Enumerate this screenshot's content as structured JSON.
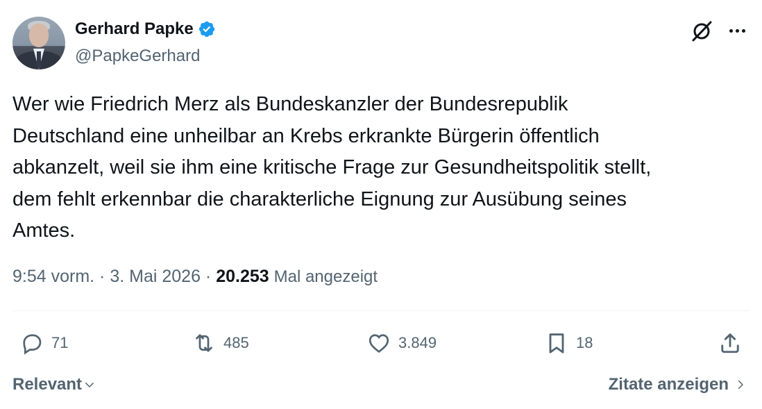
{
  "author": {
    "name": "Gerhard Papke",
    "handle": "@PapkeGerhard",
    "verified": true
  },
  "tweet": {
    "text": "Wer wie Friedrich Merz als Bundeskanzler der Bundesrepublik\nDeutschland eine unheilbar an Krebs erkrankte Bürgerin öffentlich\nabkanzelt, weil sie ihm eine kritische Frage zur Gesundheitspolitik stellt,\ndem fehlt erkennbar die charakterliche Eignung zur Ausübung seines\nAmtes."
  },
  "meta": {
    "time": "9:54 vorm.",
    "separator1": " · ",
    "date": "3. Mai 2026",
    "separator2": " · ",
    "views": "20.253",
    "views_label": "Mal angezeigt"
  },
  "actions": {
    "replies": "71",
    "retweets": "485",
    "likes": "3.849",
    "bookmarks": "18"
  },
  "footer": {
    "sort_label": "Relevant",
    "quotes_label": "Zitate anzeigen"
  },
  "icons": [
    "verified-badge-icon",
    "grok-icon",
    "more-icon",
    "reply-icon",
    "retweet-icon",
    "like-icon",
    "bookmark-icon",
    "share-icon",
    "chevron-down-icon",
    "chevron-right-icon"
  ],
  "colors": {
    "verified": "#1d9bf0",
    "text": "#0f1419",
    "secondary": "#536471",
    "divider": "#eff3f4"
  }
}
